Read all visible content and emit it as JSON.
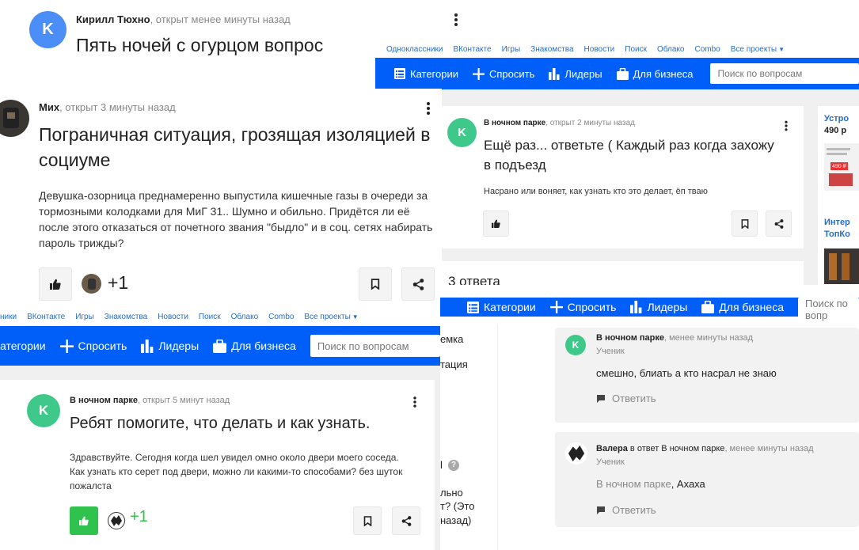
{
  "colors": {
    "brand_blue": "#005ff9",
    "link_blue": "#2a6cc0",
    "green": "#2fc24c",
    "avatar_blue": "#4c8ef7",
    "avatar_green": "#3ec98a"
  },
  "nav": {
    "links": [
      "Одноклассники",
      "ВКонтакте",
      "Игры",
      "Знакомства",
      "Новости",
      "Поиск",
      "Облако",
      "Combo",
      "Все проекты"
    ],
    "left_links": [
      "ники",
      "ВКонтакте",
      "Игры",
      "Знакомства",
      "Новости",
      "Поиск",
      "Облако",
      "Combo",
      "Все проекты"
    ],
    "categories": "Категории",
    "categories_cut": "атегории",
    "ask": "Спросить",
    "leaders": "Лидеры",
    "business": "Для бизнеса",
    "search_placeholder": "Поиск по вопросам",
    "search_placeholder_cut": "Поиск по вопр"
  },
  "q1": {
    "avatar_letter": "K",
    "author": "Кирилл Тюхно",
    "time": ", открыт менее минуты назад",
    "title": "Пять ночей с огурцом вопрос"
  },
  "q2": {
    "author": "Мих",
    "time": ", открыт 3 минуты назад",
    "title": "Пограничная ситуация, грозящая изоляцией в социуме",
    "body": "Девушка-озорница преднамеренно выпустила кишечные газы в очереди за тормозными колодками для МиГ 31.. Шумно и обильно. Придётся ли её после этого отказаться от почетного звания \"быдло\" и в соц. сетях набирать пароль трижды?",
    "plus": "+1"
  },
  "q3": {
    "avatar_letter": "K",
    "author": "В ночном парке",
    "time": ", открыт 2 минуты назад",
    "title": "Ещё раз... ответьте ( Каждый раз когда захожу в подъезд",
    "body": "Насрано или воняет, как узнать кто это делает, ёп тваю",
    "answers_count": "3 ответа"
  },
  "ads": {
    "ad1_title": "Устро",
    "ad1_price": "490 р",
    "ad1_img_price": "490 ₽",
    "ad2_title": "Интер",
    "ad2_sub": "ТопКо"
  },
  "q4": {
    "avatar_letter": "K",
    "author": "В ночном парке",
    "time": ", открыт 5 минут назад",
    "title": "Ребят помогите, что делать и как узнать.",
    "body": "Здравствуйте. Сегодня когда шел увидел омно около двери моего соседа. Как узнать кто серет под двери, можно ли какими-то способами? без шуток пожалста",
    "plus": "+1"
  },
  "side_fragments": [
    "емка",
    "тация",
    "l",
    "?",
    "льно",
    "т? (Это",
    "назад)"
  ],
  "answer1": {
    "avatar_letter": "K",
    "author": "В ночном парке",
    "time": ", менее минуты назад",
    "rank": "Ученик",
    "text": "смешно, блиать а кто насрал не знаю",
    "reply": "Ответить"
  },
  "answer2": {
    "author": "Валера",
    "in_reply": " в ответ В ночном парке",
    "time": ", менее минуты назад",
    "rank": "Ученик",
    "mention": "В ночном парке",
    "text": ", Ахаха",
    "reply": "Ответить"
  }
}
